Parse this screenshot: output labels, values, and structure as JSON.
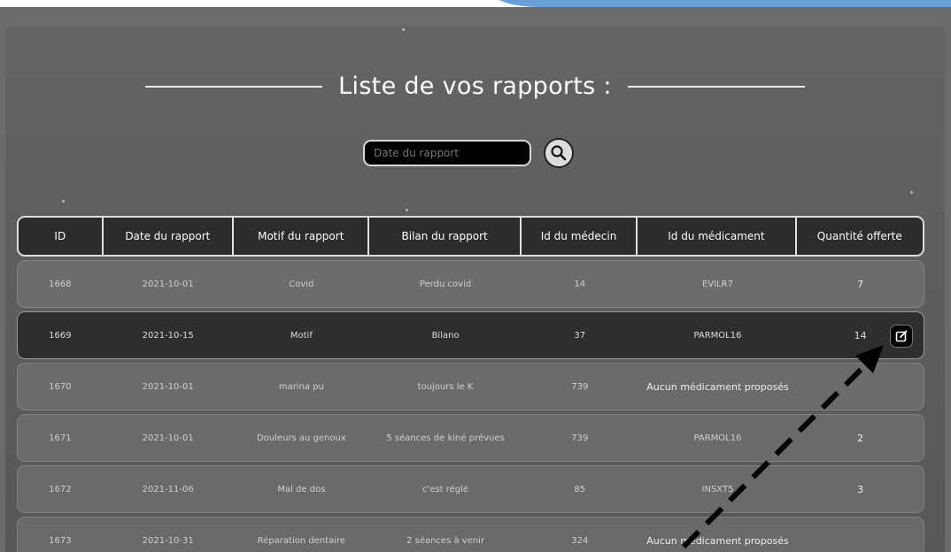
{
  "page": {
    "title": "Liste de vos rapports :",
    "search_placeholder": "Date du rapport"
  },
  "icons": {
    "search": "search-icon",
    "edit": "edit-icon",
    "annotation_arrow": "dashed-arrow"
  },
  "colors": {
    "header_bg": "#2b2b2b",
    "selected_row_bg": "#2e2e2e",
    "top_accent": "#6aa0d8"
  },
  "table": {
    "columns": [
      "ID",
      "Date du rapport",
      "Motif du rapport",
      "Bilan du rapport",
      "Id du médecin",
      "Id du médicament",
      "Quantité offerte"
    ],
    "rows": [
      [
        "1668",
        "2021-10-01",
        "Covid",
        "Perdu covid",
        "14",
        "EVILR7",
        "7"
      ],
      [
        "1669",
        "2021-10-15",
        "Motif",
        "Bilano",
        "37",
        "PARMOL16",
        "14"
      ],
      [
        "1670",
        "2021-10-01",
        "marina pu",
        "toujours le K",
        "739",
        "Aucun médicament proposés",
        ""
      ],
      [
        "1671",
        "2021-10-01",
        "Douleurs au genoux",
        "5 séances de kiné prévues",
        "739",
        "PARMOL16",
        "2"
      ],
      [
        "1672",
        "2021-11-06",
        "Mal de dos",
        "c'est réglé",
        "85",
        "INSXT5",
        "3"
      ],
      [
        "1673",
        "2021-10-31",
        "Réparation dentaire",
        "2 séances à venir",
        "324",
        "Aucun médicament proposés",
        ""
      ]
    ]
  }
}
